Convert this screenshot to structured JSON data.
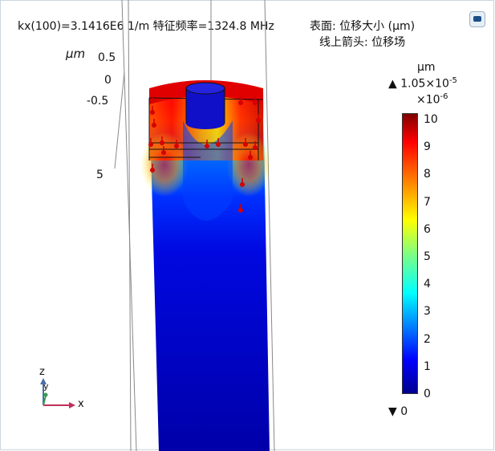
{
  "header": {
    "line1": "kx(100)=3.1416E6 1/m 特征频率=1324.8 MHz",
    "line2": "表面: 位移大小 (μm)",
    "line3": "线上箭头: 位移场"
  },
  "axis": {
    "unit": "μm",
    "ticks": [
      "0.5",
      "0",
      "-0.5",
      "5"
    ]
  },
  "colorbar": {
    "unit": "μm",
    "max_marker": "▲",
    "max_value": "1.05×10",
    "max_exp": "-5",
    "multiplier": "×10",
    "multiplier_exp": "-6",
    "ticks": [
      "10",
      "9",
      "8",
      "7",
      "6",
      "5",
      "4",
      "3",
      "2",
      "1",
      "0"
    ],
    "min_marker": "▼",
    "min_value": "0",
    "colormap": [
      "#00008f",
      "#0000ff",
      "#0080ff",
      "#00ffff",
      "#80ff80",
      "#ffff00",
      "#ff8000",
      "#ff0000",
      "#800000"
    ]
  },
  "triad": {
    "z": "z",
    "y": "y",
    "x": "x"
  },
  "icons": {
    "logo": "comsol-logo-icon"
  }
}
